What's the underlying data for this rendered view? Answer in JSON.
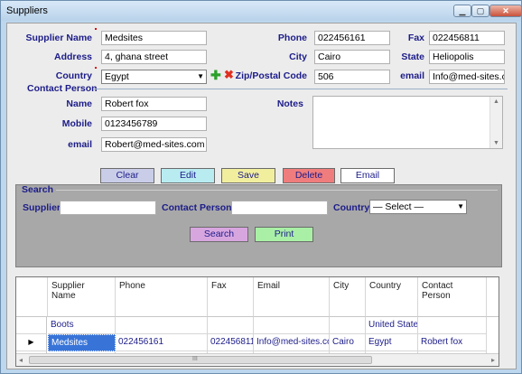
{
  "window": {
    "title": "Suppliers",
    "minimize": "▁",
    "maximize": "▢",
    "close": "✕"
  },
  "form": {
    "supplier_name": {
      "label": "Supplier Name",
      "value": "Medsites"
    },
    "address": {
      "label": "Address",
      "value": "4, ghana street"
    },
    "country": {
      "label": "Country",
      "value": "Egypt"
    },
    "phone": {
      "label": "Phone",
      "value": "022456161"
    },
    "fax": {
      "label": "Fax",
      "value": "022456811"
    },
    "city": {
      "label": "City",
      "value": "Cairo"
    },
    "state": {
      "label": "State",
      "value": "Heliopolis"
    },
    "zip": {
      "label": "Zip/Postal Code",
      "value": "506"
    },
    "email": {
      "label": "email",
      "value": "Info@med-sites.c"
    },
    "contact_group_label": "Contact Person",
    "contact_name": {
      "label": "Name",
      "value": "Robert fox"
    },
    "contact_mobile": {
      "label": "Mobile",
      "value": "0123456789"
    },
    "contact_email": {
      "label": "email",
      "value": "Robert@med-sites.com"
    },
    "notes": {
      "label": "Notes",
      "value": ""
    },
    "icons": {
      "add": "plus-icon",
      "remove": "x-icon"
    }
  },
  "actions": {
    "clear": "Clear",
    "edit": "Edit",
    "save": "Save",
    "delete": "Delete",
    "email": "Email",
    "colors": {
      "clear": "#c9cde8",
      "edit": "#b8ecf1",
      "save": "#f1ee9e",
      "delete": "#f07d7d",
      "email": "#ffffff"
    }
  },
  "search": {
    "group_label": "Search",
    "supplier_label": "Supplier",
    "supplier_value": "",
    "contact_label": "Contact Person",
    "contact_value": "",
    "country_label": "Country",
    "country_value": "— Select —",
    "search_button": "Search",
    "print_button": "Print"
  },
  "grid": {
    "columns": [
      "Supplier Name",
      "Phone",
      "Fax",
      "Email",
      "City",
      "Country",
      "Contact Person"
    ],
    "rows": [
      {
        "indicator": "",
        "cells": [
          "Boots",
          "",
          "",
          "",
          "",
          "United States",
          ""
        ]
      },
      {
        "indicator": "▶",
        "cells": [
          "Medsites",
          "022456161",
          "022456811",
          "Info@med-sites.com",
          "Cairo",
          "Egypt",
          "Robert fox"
        ]
      },
      {
        "indicator": "*",
        "cells": [
          "",
          "",
          "",
          "",
          "",
          "",
          ""
        ]
      }
    ],
    "scroll_left": "◂",
    "scroll_right": "▸",
    "scroll_grip": "III"
  }
}
